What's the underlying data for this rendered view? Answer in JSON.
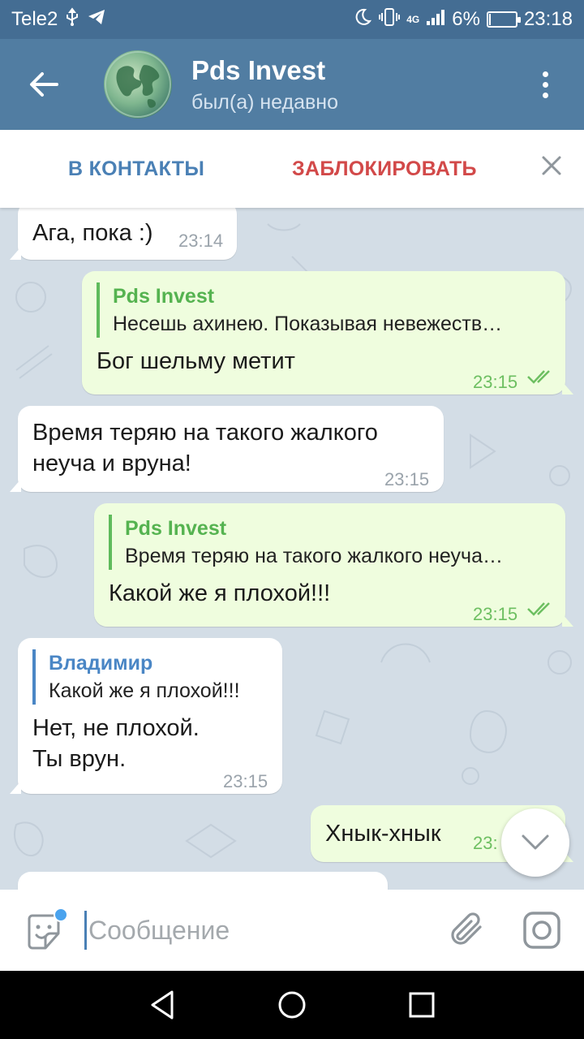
{
  "status_bar": {
    "carrier": "Tele2",
    "network": "4G",
    "battery": "6%",
    "battery_level": 0.06,
    "time": "23:18"
  },
  "header": {
    "title": "Pds Invest",
    "subtitle": "был(а) недавно"
  },
  "action_bar": {
    "add_contact": "В КОНТАКТЫ",
    "block": "ЗАБЛОКИРОВАТЬ"
  },
  "messages": [
    {
      "direction": "in",
      "text": "Ага, пока :)",
      "time": "23:14"
    },
    {
      "direction": "out",
      "reply_name": "Pds Invest",
      "reply_text": "Несешь ахинею. Показывая невежеств…",
      "text": "Бог шельму метит",
      "time": "23:15",
      "status": "read"
    },
    {
      "direction": "in",
      "text_lines": [
        "Время теряю на такого жалкого",
        "неуча и вруна!"
      ],
      "time": "23:15"
    },
    {
      "direction": "out",
      "reply_name": "Pds Invest",
      "reply_text": "Время теряю на такого жалкого неуча…",
      "text": "Какой же я плохой!!!",
      "time": "23:15",
      "status": "read"
    },
    {
      "direction": "in",
      "reply_name": "Владимир",
      "reply_text": "Какой же я плохой!!!",
      "text_lines": [
        "Нет, не плохой.",
        "Ты врун."
      ],
      "time": "23:15"
    },
    {
      "direction": "out",
      "text": "Хнык-хнык",
      "time_partial": "23:"
    }
  ],
  "composer": {
    "placeholder": "Сообщение"
  },
  "colors": {
    "header": "#517da2",
    "status_bar": "#446d93",
    "outgoing_bubble": "#effdde",
    "incoming_bubble": "#ffffff",
    "chat_background": "#d3dde6",
    "block_red": "#d24949",
    "accent_blue": "#4a80b5"
  }
}
